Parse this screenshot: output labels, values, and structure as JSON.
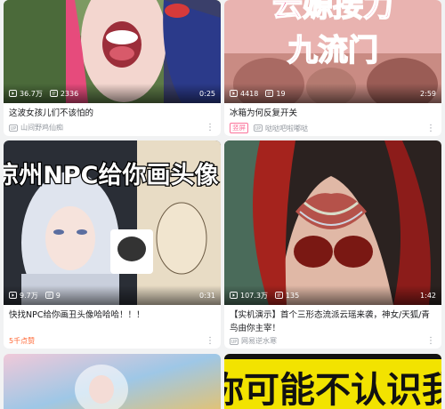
{
  "feed": [
    {
      "views": "36.7万",
      "comments": "2336",
      "duration": "0:25",
      "title": "这波女孩儿们不该怕的",
      "up_name": "山间野鸡仙痴",
      "tag": "",
      "overlay_text": ""
    },
    {
      "views": "4418",
      "comments": "19",
      "duration": "2:59",
      "title": "冰箱为何反复开关",
      "up_name": "哒哒吧啦嘟哒",
      "tag": "竖屏",
      "overlay_text": [
        "云嫄接力",
        "九流门"
      ]
    },
    {
      "views": "9.7万",
      "comments": "9",
      "duration": "0:31",
      "title": "快找NPC给你画丑头像哈哈哈！！！",
      "hot_label": "5千点赞",
      "overlay_text": "凉州NPC给你画头像!"
    },
    {
      "views": "107.3万",
      "comments": "135",
      "duration": "1:42",
      "title": "【实机演示】首个三形态流派云瑶来袭，神女/天狐/青鸟由你主宰！",
      "up_name": "网易逆水寒",
      "tag": ""
    },
    {
      "overlay_text": ""
    },
    {
      "overlay_text": "你可能不认识我"
    }
  ],
  "colors": {
    "accent_pink": "#fb7299",
    "hot_orange": "#ff6633",
    "meta_gray": "#9499a0"
  },
  "icons": {
    "views": "play-icon",
    "comments": "danmaku-icon",
    "up": "up-icon",
    "more": "more-icon"
  }
}
